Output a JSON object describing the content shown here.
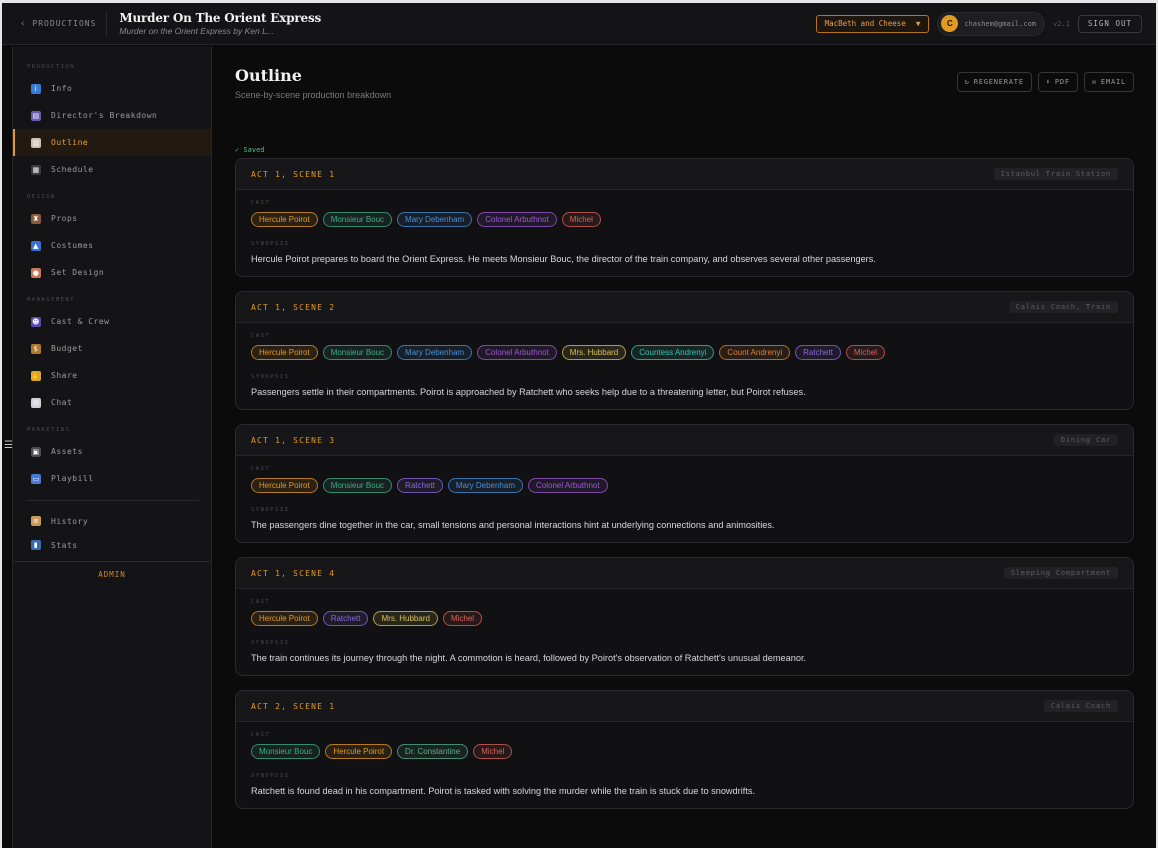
{
  "topbar": {
    "back_label": "PRODUCTIONS",
    "show_title": "Murder On The Orient Express",
    "show_subtitle": "Murder on the Orient Express by Ken L...",
    "production_select": "MacBeth and Cheese",
    "avatar_initial": "C",
    "user_email": "chashem@gmail.com",
    "version": "v2.1",
    "sign_out": "SIGN OUT"
  },
  "sidebar": {
    "sections": [
      {
        "label": "PRODUCTION",
        "items": [
          {
            "label": "Info",
            "icon": "info-icon",
            "color": "#3a7bd5",
            "glyph": "i"
          },
          {
            "label": "Director's Breakdown",
            "icon": "clapperboard-icon",
            "color": "#6b5bb0",
            "glyph": "▤"
          },
          {
            "label": "Outline",
            "icon": "clipboard-icon",
            "color": "#c9c2b0",
            "glyph": "▥",
            "active": true
          },
          {
            "label": "Schedule",
            "icon": "calendar-icon",
            "color": "#3a3a40",
            "glyph": "▦"
          }
        ]
      },
      {
        "label": "DESIGN",
        "items": [
          {
            "label": "Props",
            "icon": "chair-icon",
            "color": "#8a5a3a",
            "glyph": "♜"
          },
          {
            "label": "Costumes",
            "icon": "dress-icon",
            "color": "#3a6fd5",
            "glyph": "▲"
          },
          {
            "label": "Set Design",
            "icon": "palette-icon",
            "color": "#c77a5a",
            "glyph": "●"
          }
        ]
      },
      {
        "label": "MANAGEMENT",
        "items": [
          {
            "label": "Cast & Crew",
            "icon": "people-icon",
            "color": "#5a4ab0",
            "glyph": "☻"
          },
          {
            "label": "Budget",
            "icon": "money-bag-icon",
            "color": "#b07a2a",
            "glyph": "$"
          },
          {
            "label": "Share",
            "icon": "handshake-icon",
            "color": "#d9a52a",
            "glyph": "✋"
          },
          {
            "label": "Chat",
            "icon": "speech-bubble-icon",
            "color": "#d0d0d8",
            "glyph": "✉"
          }
        ]
      },
      {
        "label": "MARKETING",
        "items": [
          {
            "label": "Assets",
            "icon": "image-icon",
            "color": "#4a4a52",
            "glyph": "▣"
          },
          {
            "label": "Playbill",
            "icon": "book-icon",
            "color": "#4a7ad5",
            "glyph": "▭"
          }
        ]
      }
    ],
    "extra_items": [
      {
        "label": "History",
        "icon": "scroll-icon",
        "color": "#c99a5a",
        "glyph": "≡"
      },
      {
        "label": "Stats",
        "icon": "bar-chart-icon",
        "color": "#3a6ab0",
        "glyph": "▮"
      }
    ],
    "admin_label": "ADMIN"
  },
  "main": {
    "title": "Outline",
    "subtitle": "Scene-by-scene production breakdown",
    "actions": [
      {
        "label": "REGENERATE",
        "icon": "refresh-icon",
        "glyph": "↻"
      },
      {
        "label": "PDF",
        "icon": "download-icon",
        "glyph": "⬇"
      },
      {
        "label": "EMAIL",
        "icon": "mail-icon",
        "glyph": "✉"
      }
    ],
    "saved_status": "✓ Saved",
    "cast_label": "CAST",
    "synopsis_label": "SYNOPSIS"
  },
  "colors": {
    "Hercule Poirot": "#e39a1f",
    "Monsieur Bouc": "#3fae85",
    "Mary Debenham": "#4a8fd5",
    "Colonel Arbuthnot": "#9a5ad0",
    "Michel": "#d9605a",
    "Mrs. Hubbard": "#d9c25a",
    "Countess Andrenyi": "#3ac2b0",
    "Count Andrenyi": "#d9803a",
    "Ratchett": "#8a6ad9",
    "Dr. Constantine": "#5ab08a"
  },
  "scenes": [
    {
      "number": "ACT 1, SCENE 1",
      "location": "Istanbul Train Station",
      "cast": [
        "Hercule Poirot",
        "Monsieur Bouc",
        "Mary Debenham",
        "Colonel Arbuthnot",
        "Michel"
      ],
      "synopsis": "Hercule Poirot prepares to board the Orient Express. He meets Monsieur Bouc, the director of the train company, and observes several other passengers."
    },
    {
      "number": "ACT 1, SCENE 2",
      "location": "Calais Coach, Train",
      "cast": [
        "Hercule Poirot",
        "Monsieur Bouc",
        "Mary Debenham",
        "Colonel Arbuthnot",
        "Mrs. Hubbard",
        "Countess Andrenyi",
        "Count Andrenyi",
        "Ratchett",
        "Michel"
      ],
      "synopsis": "Passengers settle in their compartments. Poirot is approached by Ratchett who seeks help due to a threatening letter, but Poirot refuses."
    },
    {
      "number": "ACT 1, SCENE 3",
      "location": "Dining Car",
      "cast": [
        "Hercule Poirot",
        "Monsieur Bouc",
        "Ratchett",
        "Mary Debenham",
        "Colonel Arbuthnot"
      ],
      "synopsis": "The passengers dine together in the car, small tensions and personal interactions hint at underlying connections and animosities."
    },
    {
      "number": "ACT 1, SCENE 4",
      "location": "Sleeping Compartment",
      "cast": [
        "Hercule Poirot",
        "Ratchett",
        "Mrs. Hubbard",
        "Michel"
      ],
      "synopsis": "The train continues its journey through the night. A commotion is heard, followed by Poirot's observation of Ratchett's unusual demeanor."
    },
    {
      "number": "ACT 2, SCENE 1",
      "location": "Calais Coach",
      "cast": [
        "Monsieur Bouc",
        "Hercule Poirot",
        "Dr. Constantine",
        "Michel"
      ],
      "synopsis": "Ratchett is found dead in his compartment. Poirot is tasked with solving the murder while the train is stuck due to snowdrifts."
    }
  ]
}
